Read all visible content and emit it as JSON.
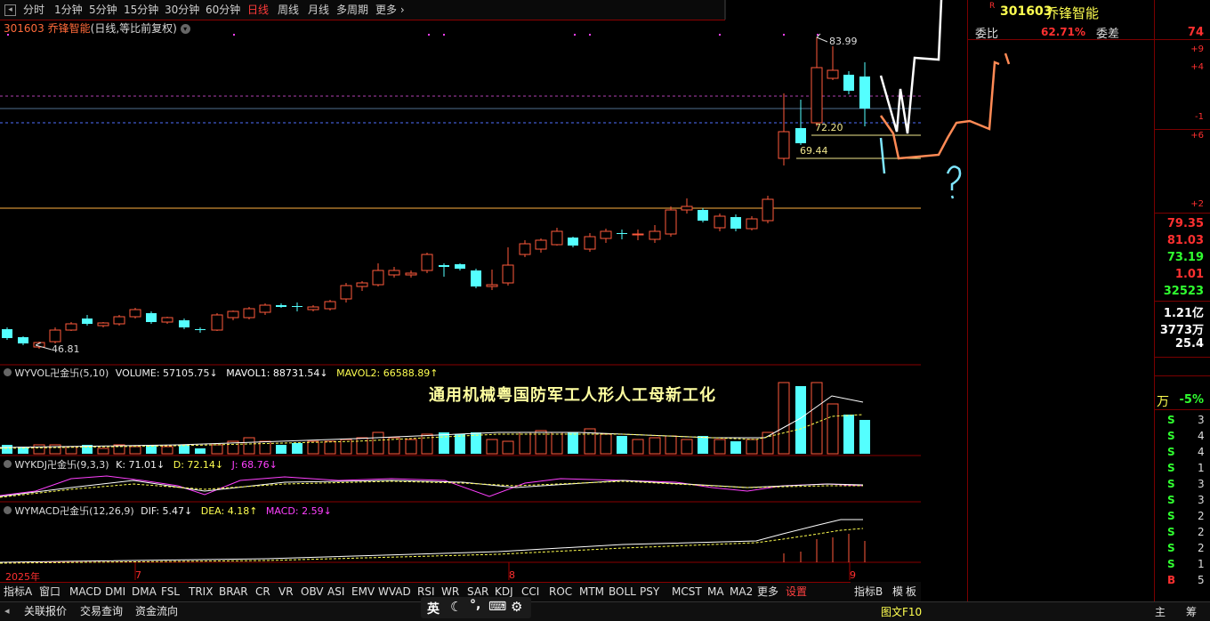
{
  "period_tabs": [
    "分时",
    "1分钟",
    "5分钟",
    "15分钟",
    "30分钟",
    "60分钟",
    "日线",
    "周线",
    "月线",
    "多周期",
    "更多"
  ],
  "active_period": "日线",
  "stock": {
    "code": "301603",
    "name": "乔锋智能",
    "chart_mode": "(日线,等比前复权)"
  },
  "price_annotations": {
    "high": "83.99",
    "low": "46.81",
    "level1": "72.20",
    "level2": "69.44"
  },
  "volume_indicator": {
    "name": "WYVOL卍金卐(5,10)",
    "volume": "VOLUME: 57105.75↓",
    "mavol1": "MAVOL1: 88731.54↓",
    "mavol2": "MAVOL2: 66588.89↑"
  },
  "concept_text": "通用机械粤国防军工人形人工母新工化",
  "kdj_indicator": {
    "name": "WYKDJ卍金卐(9,3,3)",
    "k": "K: 71.01↓",
    "d": "D: 72.14↓",
    "j": "J: 68.76↓"
  },
  "macd_indicator": {
    "name": "WYMACD卍金卐(12,26,9)",
    "dif": "DIF: 5.47↓",
    "dea": "DEA: 4.18↑",
    "macd": "MACD: 2.59↓"
  },
  "date_marks": {
    "year": "2025年",
    "m1": "7",
    "m2": "8",
    "m3": "9"
  },
  "indicator_tabs": [
    "指标A",
    "窗口",
    "MACD",
    "DMI",
    "DMA",
    "FSL",
    "TRIX",
    "BRAR",
    "CR",
    "VR",
    "OBV",
    "ASI",
    "EMV",
    "WVAD",
    "RSI",
    "WR",
    "SAR",
    "KDJ",
    "CCI",
    "ROC",
    "MTM",
    "BOLL",
    "PSY",
    "MCST",
    "MA",
    "MA2",
    "更多",
    "设置"
  ],
  "right_tabs": [
    "指标B",
    "模",
    "板"
  ],
  "status_buttons": [
    "关联报价",
    "交易查询",
    "资金流向"
  ],
  "ime_items": [
    "英",
    "☾",
    "°,",
    "⌨",
    "⚙"
  ],
  "status_right": "图文F10",
  "panel": {
    "code": "301603",
    "name": "乔锋智能",
    "r_mark": "R",
    "wei_bi_label": "委比",
    "wei_bi": "62.71%",
    "wei_cha_label": "委差",
    "wei_cha": "74",
    "ticks": [
      "+9",
      "+4",
      "-1",
      "+6",
      "+2"
    ],
    "values": [
      "79.35",
      "81.03",
      "73.19",
      "1.01",
      "32523",
      "1.21亿",
      "3773万",
      "25.4"
    ],
    "wan_label": "万",
    "pct": "-5%",
    "trades": [
      [
        "S",
        "3"
      ],
      [
        "S",
        "4"
      ],
      [
        "S",
        "4"
      ],
      [
        "S",
        "1"
      ],
      [
        "S",
        "3"
      ],
      [
        "S",
        "3"
      ],
      [
        "S",
        "2"
      ],
      [
        "S",
        "2"
      ],
      [
        "S",
        "2"
      ],
      [
        "S",
        "1"
      ],
      [
        "B",
        "5"
      ]
    ],
    "bottom": [
      "主",
      "筹"
    ]
  },
  "colors": {
    "up": "#ff5a3c",
    "down": "#54ffff",
    "magenta": "#ff40ff",
    "yellow": "#ffff50",
    "grid_red": "#a00000"
  }
}
